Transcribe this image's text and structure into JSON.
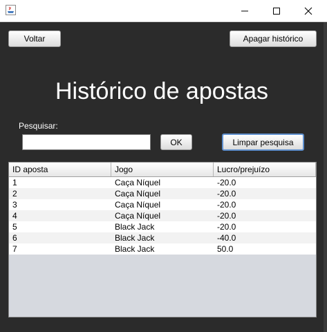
{
  "window": {
    "minimize_icon": "minimize-icon",
    "maximize_icon": "maximize-icon",
    "close_icon": "close-icon"
  },
  "toolbar": {
    "back_label": "Voltar",
    "clear_history_label": "Apagar histórico"
  },
  "page": {
    "title": "Histórico de apostas"
  },
  "search": {
    "label": "Pesquisar:",
    "value": "",
    "ok_label": "OK",
    "clear_label": "Limpar pesquisa"
  },
  "table": {
    "columns": [
      "ID aposta",
      "Jogo",
      "Lucro/prejuízo"
    ],
    "rows": [
      [
        "1",
        "Caça Níquel",
        "-20.0"
      ],
      [
        "2",
        "Caça Níquel",
        "-20.0"
      ],
      [
        "3",
        "Caça Níquel",
        "-20.0"
      ],
      [
        "4",
        "Caça Níquel",
        "-20.0"
      ],
      [
        "5",
        "Black Jack",
        "-20.0"
      ],
      [
        "6",
        "Black Jack",
        "-40.0"
      ],
      [
        "7",
        "Black Jack",
        "50.0"
      ]
    ]
  },
  "colors": {
    "background": "#2b2b2b",
    "focus_border": "#5e8fce",
    "table_empty": "#d6d9df"
  }
}
